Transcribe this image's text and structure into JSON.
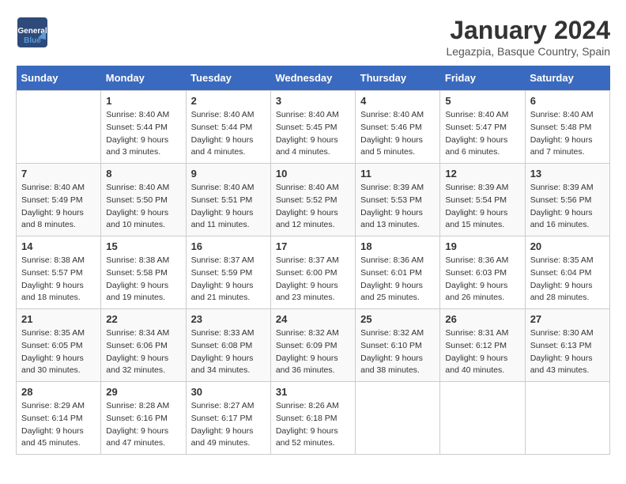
{
  "logo": {
    "line1": "General",
    "line2": "Blue"
  },
  "title": "January 2024",
  "subtitle": "Legazpia, Basque Country, Spain",
  "days_of_week": [
    "Sunday",
    "Monday",
    "Tuesday",
    "Wednesday",
    "Thursday",
    "Friday",
    "Saturday"
  ],
  "weeks": [
    [
      {
        "day": "",
        "content": ""
      },
      {
        "day": "1",
        "content": "Sunrise: 8:40 AM\nSunset: 5:44 PM\nDaylight: 9 hours\nand 3 minutes."
      },
      {
        "day": "2",
        "content": "Sunrise: 8:40 AM\nSunset: 5:44 PM\nDaylight: 9 hours\nand 4 minutes."
      },
      {
        "day": "3",
        "content": "Sunrise: 8:40 AM\nSunset: 5:45 PM\nDaylight: 9 hours\nand 4 minutes."
      },
      {
        "day": "4",
        "content": "Sunrise: 8:40 AM\nSunset: 5:46 PM\nDaylight: 9 hours\nand 5 minutes."
      },
      {
        "day": "5",
        "content": "Sunrise: 8:40 AM\nSunset: 5:47 PM\nDaylight: 9 hours\nand 6 minutes."
      },
      {
        "day": "6",
        "content": "Sunrise: 8:40 AM\nSunset: 5:48 PM\nDaylight: 9 hours\nand 7 minutes."
      }
    ],
    [
      {
        "day": "7",
        "content": "Sunrise: 8:40 AM\nSunset: 5:49 PM\nDaylight: 9 hours\nand 8 minutes."
      },
      {
        "day": "8",
        "content": "Sunrise: 8:40 AM\nSunset: 5:50 PM\nDaylight: 9 hours\nand 10 minutes."
      },
      {
        "day": "9",
        "content": "Sunrise: 8:40 AM\nSunset: 5:51 PM\nDaylight: 9 hours\nand 11 minutes."
      },
      {
        "day": "10",
        "content": "Sunrise: 8:40 AM\nSunset: 5:52 PM\nDaylight: 9 hours\nand 12 minutes."
      },
      {
        "day": "11",
        "content": "Sunrise: 8:39 AM\nSunset: 5:53 PM\nDaylight: 9 hours\nand 13 minutes."
      },
      {
        "day": "12",
        "content": "Sunrise: 8:39 AM\nSunset: 5:54 PM\nDaylight: 9 hours\nand 15 minutes."
      },
      {
        "day": "13",
        "content": "Sunrise: 8:39 AM\nSunset: 5:56 PM\nDaylight: 9 hours\nand 16 minutes."
      }
    ],
    [
      {
        "day": "14",
        "content": "Sunrise: 8:38 AM\nSunset: 5:57 PM\nDaylight: 9 hours\nand 18 minutes."
      },
      {
        "day": "15",
        "content": "Sunrise: 8:38 AM\nSunset: 5:58 PM\nDaylight: 9 hours\nand 19 minutes."
      },
      {
        "day": "16",
        "content": "Sunrise: 8:37 AM\nSunset: 5:59 PM\nDaylight: 9 hours\nand 21 minutes."
      },
      {
        "day": "17",
        "content": "Sunrise: 8:37 AM\nSunset: 6:00 PM\nDaylight: 9 hours\nand 23 minutes."
      },
      {
        "day": "18",
        "content": "Sunrise: 8:36 AM\nSunset: 6:01 PM\nDaylight: 9 hours\nand 25 minutes."
      },
      {
        "day": "19",
        "content": "Sunrise: 8:36 AM\nSunset: 6:03 PM\nDaylight: 9 hours\nand 26 minutes."
      },
      {
        "day": "20",
        "content": "Sunrise: 8:35 AM\nSunset: 6:04 PM\nDaylight: 9 hours\nand 28 minutes."
      }
    ],
    [
      {
        "day": "21",
        "content": "Sunrise: 8:35 AM\nSunset: 6:05 PM\nDaylight: 9 hours\nand 30 minutes."
      },
      {
        "day": "22",
        "content": "Sunrise: 8:34 AM\nSunset: 6:06 PM\nDaylight: 9 hours\nand 32 minutes."
      },
      {
        "day": "23",
        "content": "Sunrise: 8:33 AM\nSunset: 6:08 PM\nDaylight: 9 hours\nand 34 minutes."
      },
      {
        "day": "24",
        "content": "Sunrise: 8:32 AM\nSunset: 6:09 PM\nDaylight: 9 hours\nand 36 minutes."
      },
      {
        "day": "25",
        "content": "Sunrise: 8:32 AM\nSunset: 6:10 PM\nDaylight: 9 hours\nand 38 minutes."
      },
      {
        "day": "26",
        "content": "Sunrise: 8:31 AM\nSunset: 6:12 PM\nDaylight: 9 hours\nand 40 minutes."
      },
      {
        "day": "27",
        "content": "Sunrise: 8:30 AM\nSunset: 6:13 PM\nDaylight: 9 hours\nand 43 minutes."
      }
    ],
    [
      {
        "day": "28",
        "content": "Sunrise: 8:29 AM\nSunset: 6:14 PM\nDaylight: 9 hours\nand 45 minutes."
      },
      {
        "day": "29",
        "content": "Sunrise: 8:28 AM\nSunset: 6:16 PM\nDaylight: 9 hours\nand 47 minutes."
      },
      {
        "day": "30",
        "content": "Sunrise: 8:27 AM\nSunset: 6:17 PM\nDaylight: 9 hours\nand 49 minutes."
      },
      {
        "day": "31",
        "content": "Sunrise: 8:26 AM\nSunset: 6:18 PM\nDaylight: 9 hours\nand 52 minutes."
      },
      {
        "day": "",
        "content": ""
      },
      {
        "day": "",
        "content": ""
      },
      {
        "day": "",
        "content": ""
      }
    ]
  ]
}
